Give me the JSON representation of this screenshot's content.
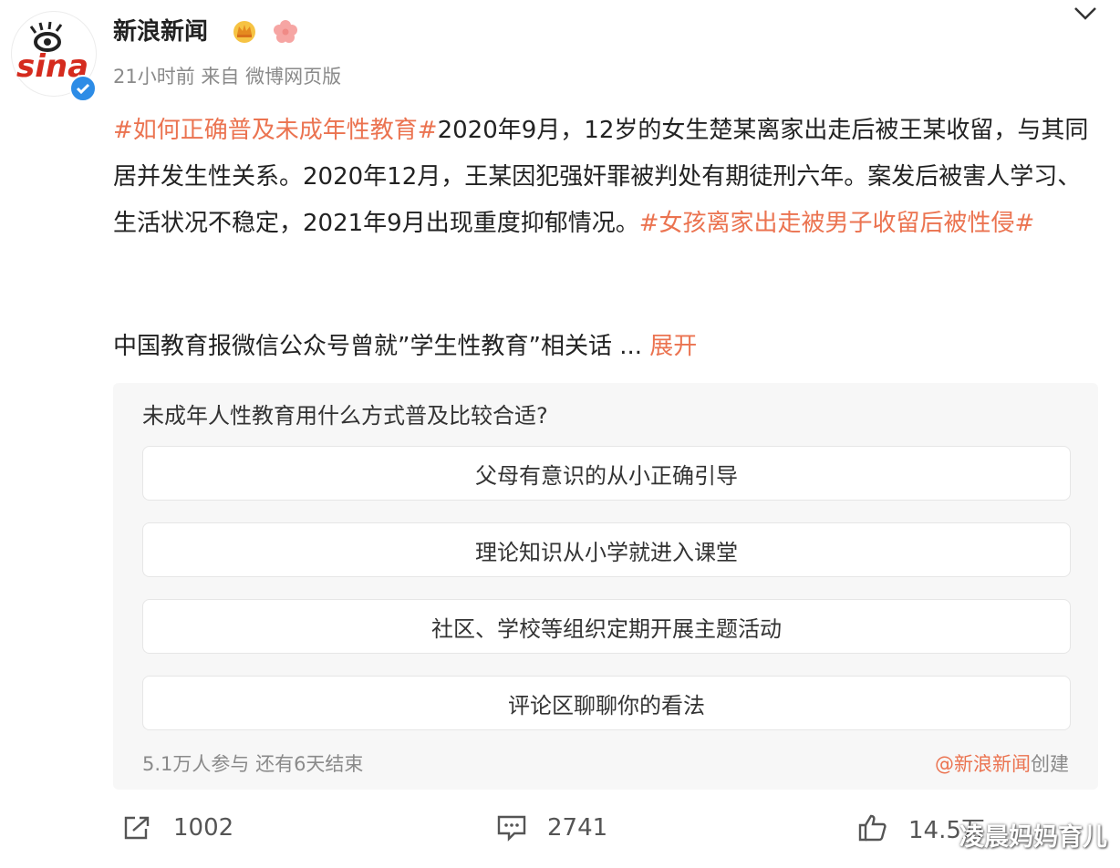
{
  "post": {
    "author": "新浪新闻",
    "meta": "21小时前  来自  微博网页版",
    "avatar_logo": "sina",
    "topic1": "#如何正确普及未成年性教育#",
    "text1": "2020年9月，12岁的女生楚某离家出走后被王某收留，与其同居并发生性关系。2020年12月，王某因犯强奸罪被判处有期徒刑六年。案发后被害人学习、生活状况不稳定，2021年9月出现重度抑郁情况。",
    "topic2": "#女孩离家出走被男子收留后被性侵#",
    "text2": "中国教育报微信公众号曾就”学生性教育”相关话",
    "ellipsis": "...",
    "expand": "展开"
  },
  "poll": {
    "question": "未成年人性教育用什么方式普及比较合适?",
    "options": [
      "父母有意识的从小正确引导",
      "理论知识从小学就进入课堂",
      "社区、学校等组织定期开展主题活动",
      "评论区聊聊你的看法"
    ],
    "stats": "5.1万人参与 还有6天结束",
    "creator_at": "@新浪新闻",
    "creator_suffix": "创建"
  },
  "actions": {
    "reposts": "1002",
    "comments": "2741",
    "likes": "14.5万"
  },
  "watermark": "凌晨妈妈育儿",
  "colors": {
    "topic": "#eb7350",
    "verified": "#2d8ce6",
    "sina_red": "#d52b1e"
  },
  "icons": [
    "chevron-down-icon",
    "crown-badge-icon",
    "flower-badge-icon",
    "verified-icon",
    "repost-icon",
    "comment-icon",
    "like-icon"
  ]
}
